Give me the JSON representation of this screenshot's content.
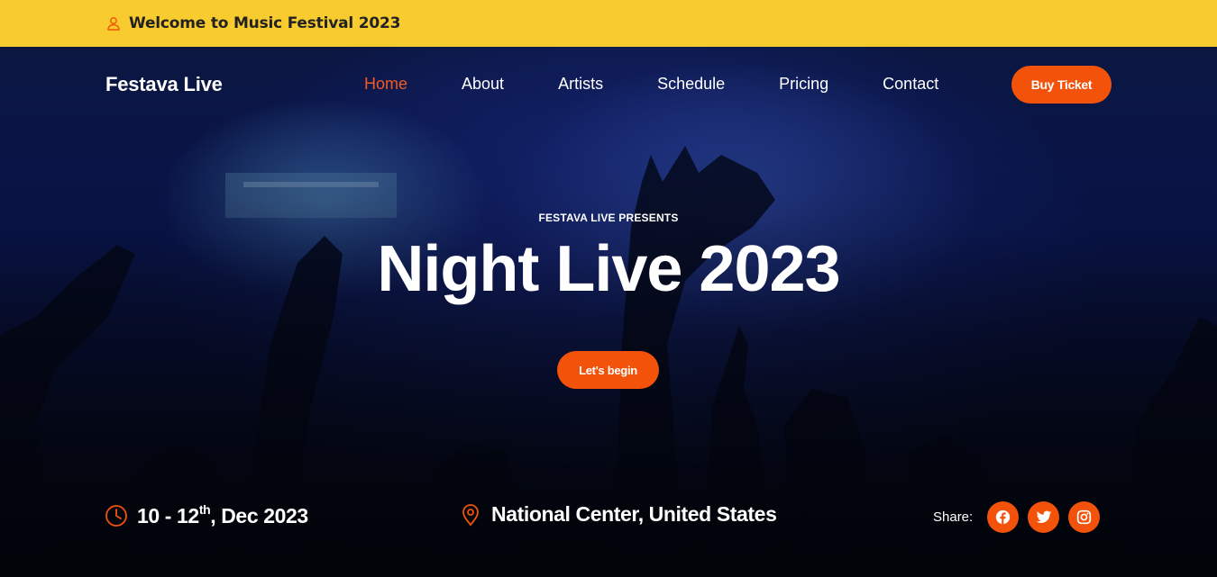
{
  "topbar": {
    "welcome": "Welcome to Music Festival 2023",
    "icon": "user-icon"
  },
  "header": {
    "logo": "Festava Live",
    "nav": [
      {
        "label": "Home",
        "active": true
      },
      {
        "label": "About",
        "active": false
      },
      {
        "label": "Artists",
        "active": false
      },
      {
        "label": "Schedule",
        "active": false
      },
      {
        "label": "Pricing",
        "active": false
      },
      {
        "label": "Contact",
        "active": false
      }
    ],
    "buy_ticket": "Buy Ticket"
  },
  "hero": {
    "presents": "FESTAVA LIVE PRESENTS",
    "title": "Night Live 2023",
    "cta": "Let's begin"
  },
  "info": {
    "date_start": "10 - 12",
    "date_sup": "th",
    "date_end": ", Dec 2023",
    "location": "National Center, United States",
    "date_icon": "clock-icon",
    "location_icon": "map-pin-icon"
  },
  "share": {
    "label": "Share:",
    "icons": [
      "facebook-icon",
      "twitter-icon",
      "instagram-icon"
    ]
  },
  "colors": {
    "accent": "#f2520a",
    "topbar": "#f8cb2e",
    "active_nav": "#f25a1f"
  }
}
